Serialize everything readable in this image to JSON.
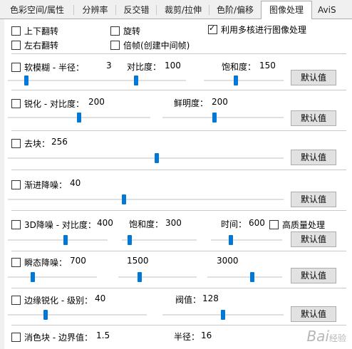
{
  "tabs": [
    "色彩空间/属性",
    "分辨率",
    "反交错",
    "裁剪/拉伸",
    "色阶/偏移",
    "图像处理",
    "AviS"
  ],
  "options": {
    "flip_v": {
      "label": "上下翻转",
      "checked": false
    },
    "rotate": {
      "label": "旋转",
      "checked": false
    },
    "multicore": {
      "label": "利用多核进行图像处理",
      "checked": true
    },
    "flip_h": {
      "label": "左右翻转",
      "checked": false
    },
    "double_frame": {
      "label": "倍帧(创建中间帧)",
      "checked": false
    }
  },
  "default_label": "默认值",
  "blur": {
    "checkbox": "软模糊 - 半径：",
    "radius": "3",
    "contrast_label": "对比度：",
    "contrast": "100",
    "saturation_label": "饱和度：",
    "saturation": "150",
    "sliders": [
      0.12,
      0.22,
      0.6
    ]
  },
  "sharpen": {
    "checkbox": "锐化 - 对比度：",
    "contrast": "200",
    "vivid_label": "鲜明度：",
    "vivid": "200",
    "sliders": [
      0.5,
      0.5
    ]
  },
  "deblock": {
    "checkbox": "去块：",
    "value": "256",
    "slider": 0.5
  },
  "denoise": {
    "checkbox": "渐进降噪：",
    "value": "40",
    "slider": 0.4
  },
  "denoise3d": {
    "checkbox": "3D降噪 - 对比度：",
    "contrast": "400",
    "saturation_label": "饱和度：",
    "saturation": "300",
    "time_label": "时间：",
    "time": "600",
    "hq": "高质量处理",
    "sliders": [
      0.5,
      0.2,
      0.3
    ]
  },
  "transient": {
    "checkbox": "瞬态降噪：",
    "v1": "700",
    "v2": "1500",
    "v3": "3000",
    "sliders": [
      0.15,
      0.2,
      0.6
    ]
  },
  "edge": {
    "checkbox": "边缘锐化 - 级别：",
    "level": "40",
    "threshold_label": "阀值：",
    "threshold": "128",
    "sliders": [
      0.3,
      0.4
    ]
  },
  "chroma": {
    "checkbox": "消色块 - 边界值：",
    "boundary": "1.5",
    "radius_label": "半径：",
    "radius": "16"
  },
  "watermark": "Bai",
  "watermark_sub": "经验"
}
